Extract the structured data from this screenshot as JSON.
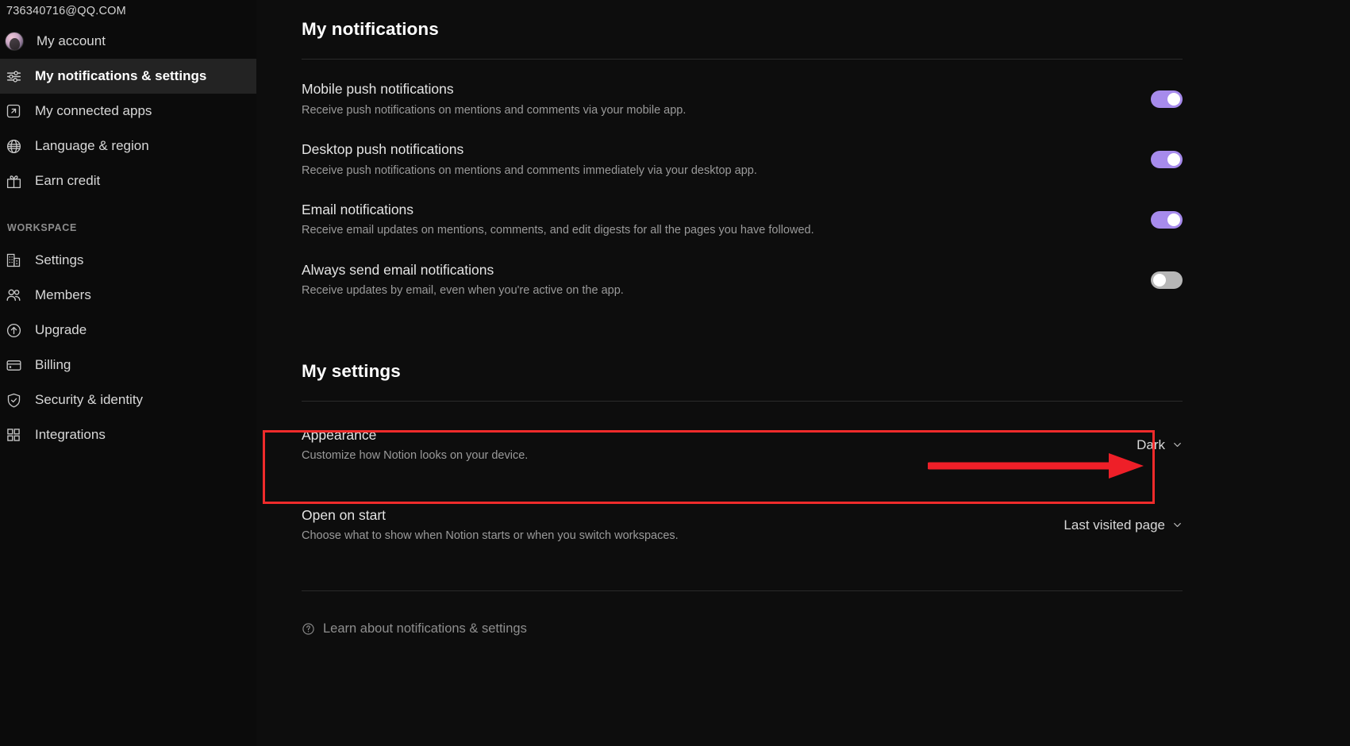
{
  "sidebar": {
    "account_email": "736340716@QQ.COM",
    "account_items": [
      {
        "id": "my-account",
        "label": "My account",
        "icon": "avatar",
        "selected": false
      },
      {
        "id": "my-notifications-settings",
        "label": "My notifications & settings",
        "icon": "sliders-icon",
        "selected": true
      },
      {
        "id": "my-connected-apps",
        "label": "My connected apps",
        "icon": "external-link-icon",
        "selected": false
      },
      {
        "id": "language-region",
        "label": "Language & region",
        "icon": "globe-icon",
        "selected": false
      },
      {
        "id": "earn-credit",
        "label": "Earn credit",
        "icon": "gift-icon",
        "selected": false
      }
    ],
    "workspace_label": "WORKSPACE",
    "workspace_items": [
      {
        "id": "settings",
        "label": "Settings",
        "icon": "building-icon",
        "selected": false
      },
      {
        "id": "members",
        "label": "Members",
        "icon": "people-icon",
        "selected": false
      },
      {
        "id": "upgrade",
        "label": "Upgrade",
        "icon": "arrow-up-circle-icon",
        "selected": false
      },
      {
        "id": "billing",
        "label": "Billing",
        "icon": "credit-card-icon",
        "selected": false
      },
      {
        "id": "security-identity",
        "label": "Security & identity",
        "icon": "shield-check-icon",
        "selected": false
      },
      {
        "id": "integrations",
        "label": "Integrations",
        "icon": "grid-icon",
        "selected": false
      }
    ]
  },
  "main": {
    "notifications_title": "My notifications",
    "notifications": [
      {
        "id": "mobile-push-notifications",
        "title": "Mobile push notifications",
        "desc": "Receive push notifications on mentions and comments via your mobile app.",
        "state": "on"
      },
      {
        "id": "desktop-push-notifications",
        "title": "Desktop push notifications",
        "desc": "Receive push notifications on mentions and comments immediately via your desktop app.",
        "state": "on"
      },
      {
        "id": "email-notifications",
        "title": "Email notifications",
        "desc": "Receive email updates on mentions, comments, and edit digests for all the pages you have followed.",
        "state": "on"
      },
      {
        "id": "always-send-email-notifications",
        "title": "Always send email notifications",
        "desc": "Receive updates by email, even when you're active on the app.",
        "state": "off"
      }
    ],
    "settings_title": "My settings",
    "settings": [
      {
        "id": "appearance",
        "title": "Appearance",
        "desc": "Customize how Notion looks on your device.",
        "value": "Dark",
        "highlighted": true
      },
      {
        "id": "open-on-start",
        "title": "Open on start",
        "desc": "Choose what to show when Notion starts or when you switch workspaces.",
        "value": "Last visited page",
        "highlighted": false
      }
    ],
    "footer_link": "Learn about notifications & settings"
  },
  "colors": {
    "toggle_on": "#a78bec",
    "toggle_off": "#b6b6b6",
    "highlight_red": "#ef2b2b",
    "selected_nav_bg": "#232323",
    "page_bg": "#0d0d0d",
    "sidebar_bg": "#0b0b0b"
  }
}
